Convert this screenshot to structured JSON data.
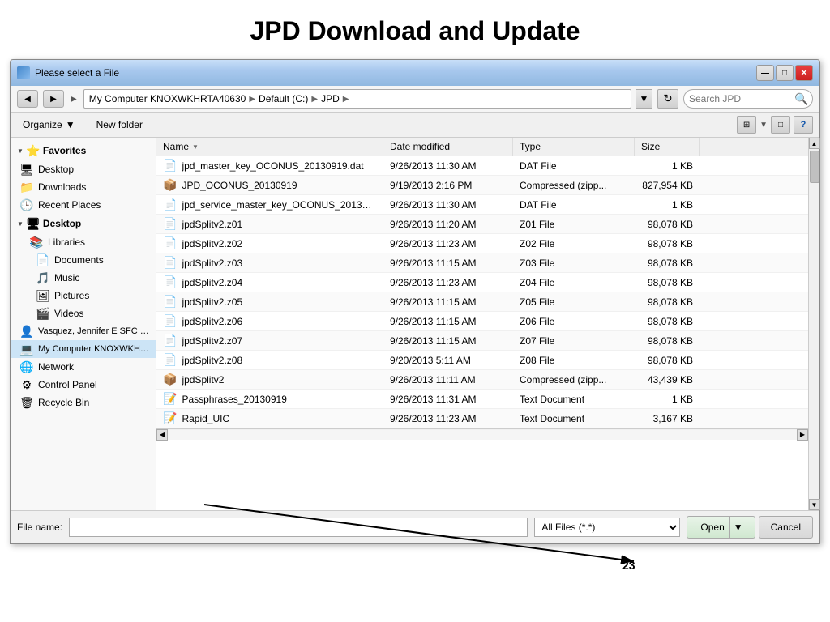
{
  "page": {
    "title": "JPD Download and Update"
  },
  "dialog": {
    "title": "Please select a File",
    "title_icon": "folder-icon"
  },
  "title_bar_controls": {
    "minimize": "—",
    "maximize": "□",
    "close": "✕"
  },
  "address_bar": {
    "back_tooltip": "Back",
    "forward_tooltip": "Forward",
    "path_parts": [
      "My Computer KNOXWKHRTA40630",
      "Default (C:)",
      "JPD"
    ],
    "refresh_tooltip": "Refresh",
    "search_placeholder": "Search JPD"
  },
  "toolbar": {
    "organize_label": "Organize",
    "new_folder_label": "New folder"
  },
  "column_headers": {
    "name": "Name",
    "date_modified": "Date modified",
    "type": "Type",
    "size": "Size"
  },
  "sidebar": {
    "favorites_label": "Favorites",
    "desktop_label": "Desktop",
    "downloads_label": "Downloads",
    "recent_places_label": "Recent Places",
    "desktop_group_label": "Desktop",
    "libraries_label": "Libraries",
    "documents_label": "Documents",
    "music_label": "Music",
    "pictures_label": "Pictures",
    "videos_label": "Videos",
    "user_label": "Vasquez, Jennifer E SFC MIL US",
    "computer_label": "My Computer KNOXWKHRTA...",
    "network_label": "Network",
    "control_panel_label": "Control Panel",
    "recycle_bin_label": "Recycle Bin"
  },
  "files": [
    {
      "name": "jpd_master_key_OCONUS_20130919.dat",
      "date_modified": "9/26/2013 11:30 AM",
      "type": "DAT File",
      "size": "1 KB",
      "icon_type": "dat"
    },
    {
      "name": "JPD_OCONUS_20130919",
      "date_modified": "9/19/2013 2:16 PM",
      "type": "Compressed (zipp...",
      "size": "827,954 KB",
      "icon_type": "zip"
    },
    {
      "name": "jpd_service_master_key_OCONUS_201309...",
      "date_modified": "9/26/2013 11:30 AM",
      "type": "DAT File",
      "size": "1 KB",
      "icon_type": "dat"
    },
    {
      "name": "jpdSplitv2.z01",
      "date_modified": "9/26/2013 11:20 AM",
      "type": "Z01 File",
      "size": "98,078 KB",
      "icon_type": "split"
    },
    {
      "name": "jpdSplitv2.z02",
      "date_modified": "9/26/2013 11:23 AM",
      "type": "Z02 File",
      "size": "98,078 KB",
      "icon_type": "split"
    },
    {
      "name": "jpdSplitv2.z03",
      "date_modified": "9/26/2013 11:15 AM",
      "type": "Z03 File",
      "size": "98,078 KB",
      "icon_type": "split"
    },
    {
      "name": "jpdSplitv2.z04",
      "date_modified": "9/26/2013 11:23 AM",
      "type": "Z04 File",
      "size": "98,078 KB",
      "icon_type": "split"
    },
    {
      "name": "jpdSplitv2.z05",
      "date_modified": "9/26/2013 11:15 AM",
      "type": "Z05 File",
      "size": "98,078 KB",
      "icon_type": "split"
    },
    {
      "name": "jpdSplitv2.z06",
      "date_modified": "9/26/2013 11:15 AM",
      "type": "Z06 File",
      "size": "98,078 KB",
      "icon_type": "split"
    },
    {
      "name": "jpdSplitv2.z07",
      "date_modified": "9/26/2013 11:15 AM",
      "type": "Z07 File",
      "size": "98,078 KB",
      "icon_type": "split"
    },
    {
      "name": "jpdSplitv2.z08",
      "date_modified": "9/20/2013 5:11 AM",
      "type": "Z08 File",
      "size": "98,078 KB",
      "icon_type": "split"
    },
    {
      "name": "jpdSplitv2",
      "date_modified": "9/26/2013 11:11 AM",
      "type": "Compressed (zipp...",
      "size": "43,439 KB",
      "icon_type": "zip"
    },
    {
      "name": "Passphrases_20130919",
      "date_modified": "9/26/2013 11:31 AM",
      "type": "Text Document",
      "size": "1 KB",
      "icon_type": "txt"
    },
    {
      "name": "Rapid_UIC",
      "date_modified": "9/26/2013 11:23 AM",
      "type": "Text Document",
      "size": "3,167 KB",
      "icon_type": "txt"
    }
  ],
  "bottom_bar": {
    "filename_label": "File name:",
    "filename_value": "",
    "filetype_label": "All Files (*.*)",
    "open_btn": "Open",
    "cancel_btn": "Cancel",
    "open_arrow": "▼"
  },
  "annotation": {
    "number": "23"
  }
}
